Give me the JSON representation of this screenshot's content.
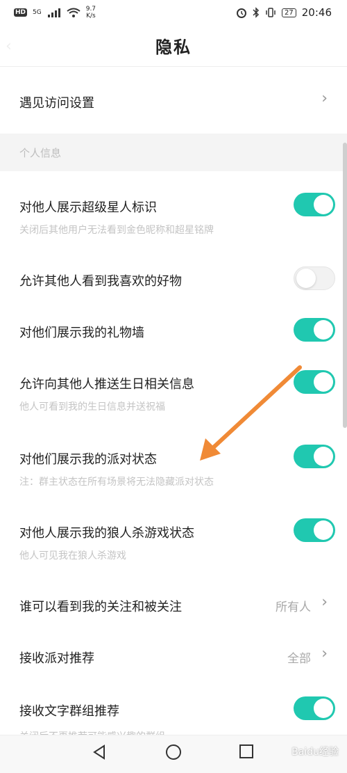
{
  "status_bar": {
    "hd": "HD",
    "net_type": "5G",
    "speed_value": "9.7",
    "speed_unit": "K/s",
    "battery": "27",
    "time": "20:46"
  },
  "header": {
    "title": "隐私"
  },
  "rows": {
    "visit_settings": {
      "title": "遇见访问设置"
    },
    "section_personal": "个人信息",
    "superstar": {
      "title": "对他人展示超级星人标识",
      "subtitle": "关闭后其他用户无法看到金色昵称和超星铭牌",
      "on": true
    },
    "liked_items": {
      "title": "允许其他人看到我喜欢的好物",
      "on": false
    },
    "gift_wall": {
      "title": "对他们展示我的礼物墙",
      "on": true
    },
    "birthday": {
      "title": "允许向其他人推送生日相关信息",
      "subtitle": "他人可看到我的生日信息并送祝福",
      "on": true
    },
    "party_status": {
      "title": "对他们展示我的派对状态",
      "subtitle": "注：群主状态在所有场景将无法隐藏派对状态",
      "on": true
    },
    "werewolf": {
      "title": "对他人展示我的狼人杀游戏状态",
      "subtitle": "他人可见我在狼人杀游戏",
      "on": true
    },
    "follow_visibility": {
      "title": "谁可以看到我的关注和被关注",
      "value": "所有人"
    },
    "party_recommend": {
      "title": "接收派对推荐",
      "value": "全部"
    },
    "group_recommend": {
      "title": "接收文字群组推荐",
      "subtitle": "关闭后不再推荐可能感兴趣的群组",
      "on": true
    }
  },
  "watermark": "Baidu经验",
  "colors": {
    "toggle_on": "#20c8b0",
    "annotation_arrow": "#f08a36"
  }
}
